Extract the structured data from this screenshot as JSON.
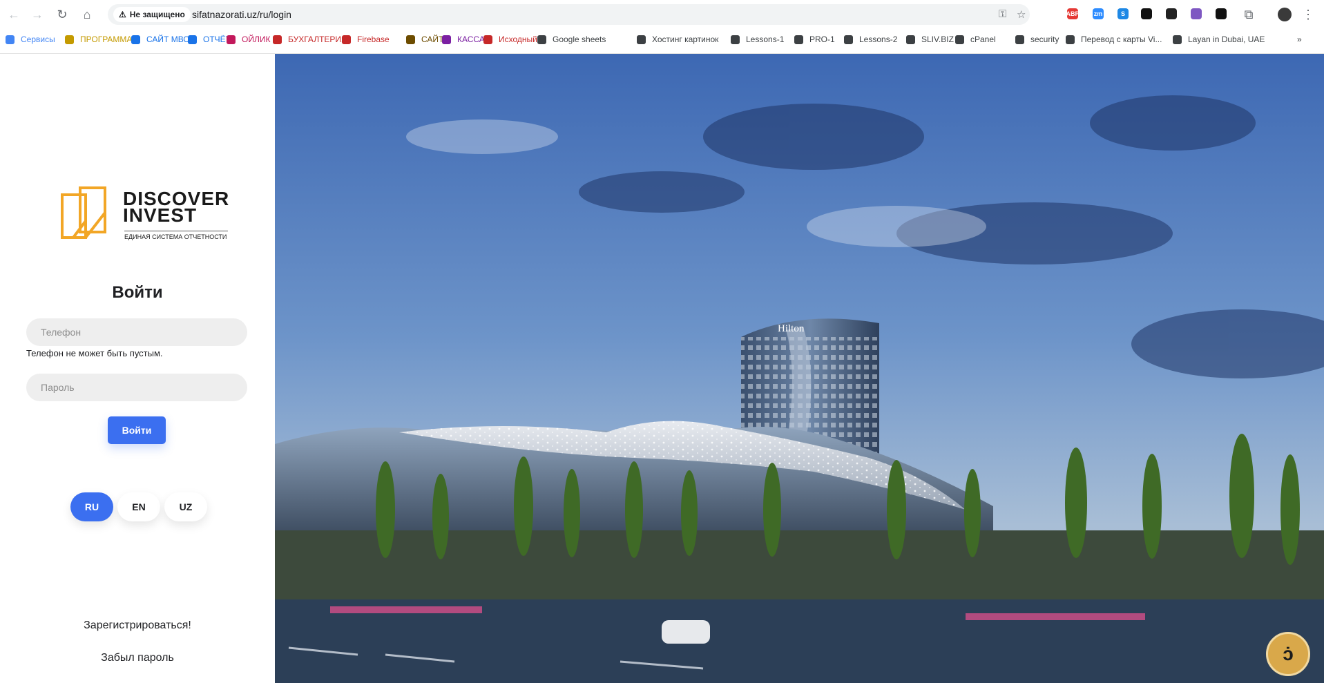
{
  "browser": {
    "security_label": "Не защищено",
    "url": "sifatnazorati.uz/ru/login",
    "bookmarks": [
      {
        "label": "Сервисы",
        "color": "#4285f4"
      },
      {
        "label": "ПРОГРАММА",
        "color": "#c49a00"
      },
      {
        "label": "САЙТ МВС",
        "color": "#1a73e8"
      },
      {
        "label": "ОТЧЁТ",
        "color": "#1a73e8"
      },
      {
        "label": "ОЙЛИК",
        "color": "#c2185b"
      },
      {
        "label": "БУХГАЛТЕРИЯ",
        "color": "#c62828"
      },
      {
        "label": "Firebase",
        "color": "#c62828"
      },
      {
        "label": "САЙТ",
        "color": "#6d4c00"
      },
      {
        "label": "КАССА",
        "color": "#7b1fa2"
      },
      {
        "label": "Исходный",
        "color": "#c62828"
      },
      {
        "label": "Google sheets",
        "color": "#3c4043"
      },
      {
        "label": "Хостинг картинок",
        "color": "#3c4043"
      },
      {
        "label": "Lessons-1",
        "color": "#3c4043"
      },
      {
        "label": "PRO-1",
        "color": "#3c4043"
      },
      {
        "label": "Lessons-2",
        "color": "#3c4043"
      },
      {
        "label": "SLIV.BIZ",
        "color": "#3c4043"
      },
      {
        "label": "cPanel",
        "color": "#3c4043"
      },
      {
        "label": "security",
        "color": "#3c4043"
      },
      {
        "label": "Перевод с карты Vi...",
        "color": "#3c4043"
      },
      {
        "label": "Layan in Dubai, UAE",
        "color": "#3c4043"
      }
    ],
    "extensions": [
      {
        "label": "ABP",
        "color": "#e53935"
      },
      {
        "label": "zm",
        "color": "#2d8cff"
      },
      {
        "label": "S",
        "color": "#1e88e5"
      },
      {
        "label": "",
        "color": "#111111"
      },
      {
        "label": "",
        "color": "#222222"
      },
      {
        "label": "",
        "color": "#7e57c2"
      },
      {
        "label": "",
        "color": "#111111"
      }
    ]
  },
  "logo": {
    "line1": "DISCOVER",
    "line2": "INVEST",
    "tagline": "ЕДИНАЯ СИСТЕМА ОТЧЕТНОСТИ",
    "accent_color": "#f2a626"
  },
  "login": {
    "title": "Войти",
    "phone_placeholder": "Телефон",
    "phone_value": "",
    "phone_error": "Телефон не может быть пустым.",
    "password_placeholder": "Пароль",
    "password_value": "",
    "submit_label": "Войти",
    "button_color": "#3b6ff0"
  },
  "languages": [
    {
      "code": "RU",
      "active": true
    },
    {
      "code": "EN",
      "active": false
    },
    {
      "code": "UZ",
      "active": false
    }
  ],
  "links": {
    "register": "Зарегистрироваться!",
    "forgot": "Забыл пароль"
  },
  "hero": {
    "building_sign": "Hilton",
    "chat_icon": "chat-bubble-icon"
  }
}
